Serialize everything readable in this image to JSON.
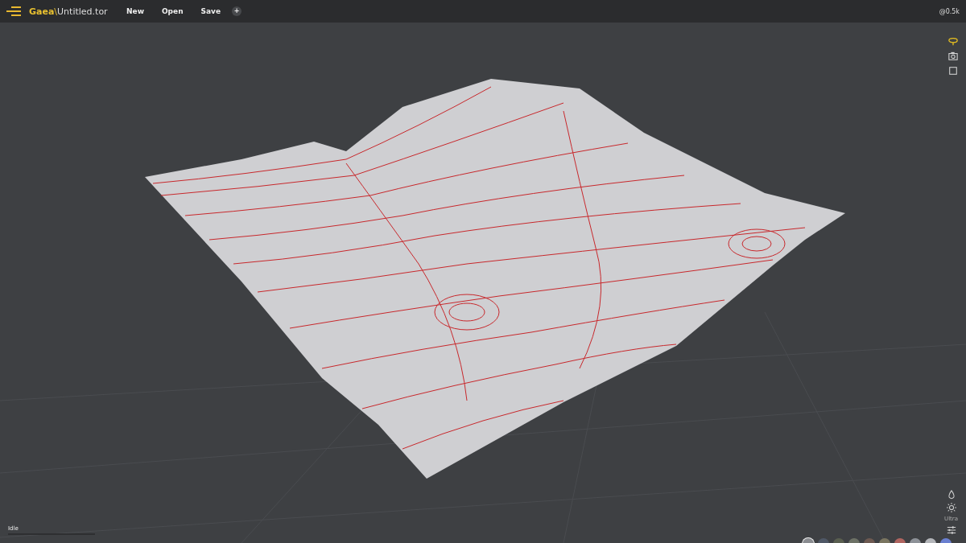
{
  "app": {
    "name": "Gaea",
    "separator": "\\",
    "file": "Untitled.tor"
  },
  "menu": [
    {
      "label": "New"
    },
    {
      "label": "Open"
    },
    {
      "label": "Save"
    },
    {
      "label": "+"
    }
  ],
  "resolution": "@0.5k",
  "view_tools": [
    {
      "kind": "orbit",
      "selected": true
    },
    {
      "kind": "camera",
      "selected": false
    },
    {
      "kind": "frame",
      "selected": false
    }
  ],
  "render_tools": [
    {
      "kind": "water"
    },
    {
      "kind": "light"
    },
    {
      "kind": "quality",
      "label": "Ultra"
    },
    {
      "kind": "settings"
    }
  ],
  "status": {
    "text": "Idle"
  },
  "materials": [
    {
      "color": "#8a8c90",
      "selected": true
    },
    {
      "color": "#4f5866",
      "selected": false
    },
    {
      "color": "#5a5f50",
      "selected": false
    },
    {
      "color": "#6d7266",
      "selected": false
    },
    {
      "color": "#6e5a52",
      "selected": false
    },
    {
      "color": "#7a7560",
      "selected": false
    },
    {
      "color": "#b06560",
      "selected": false
    },
    {
      "color": "#8e9298",
      "selected": false
    },
    {
      "color": "#b4b6ba",
      "selected": false
    },
    {
      "color": "#6a7fd0",
      "selected": false
    }
  ]
}
